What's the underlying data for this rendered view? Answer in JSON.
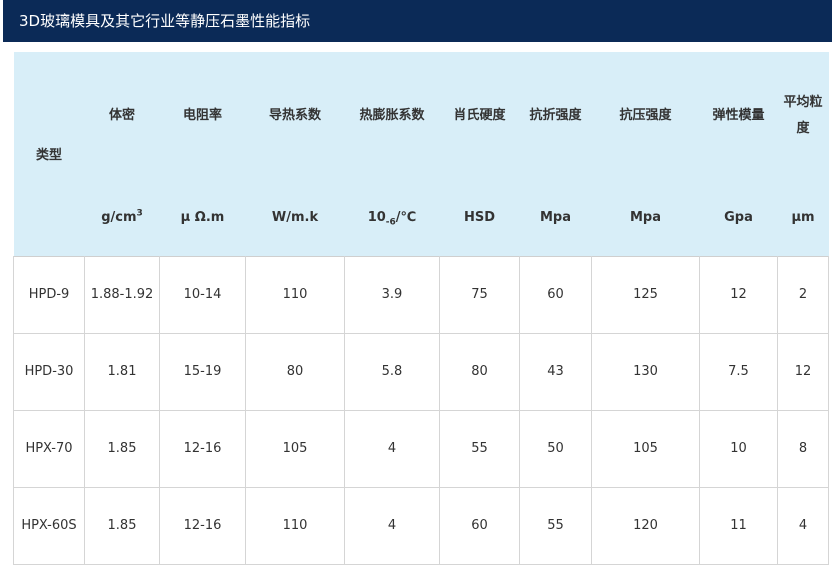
{
  "page_title": "3D玻璃模具及其它行业等静压石墨性能指标",
  "table": {
    "type_header": "类型",
    "columns": [
      {
        "name": "体密",
        "unit_main": "g/cm",
        "unit_sup": "3",
        "unit_sub": "",
        "unit_tail": ""
      },
      {
        "name": "电阻率",
        "unit_main": "μ Ω.m",
        "unit_sup": "",
        "unit_sub": "",
        "unit_tail": ""
      },
      {
        "name": "导热系数",
        "unit_main": "W/m.k",
        "unit_sup": "",
        "unit_sub": "",
        "unit_tail": ""
      },
      {
        "name": "热膨胀系数",
        "unit_main": "10",
        "unit_sup": "",
        "unit_sub": "-6",
        "unit_tail": "/℃"
      },
      {
        "name": "肖氏硬度",
        "unit_main": "HSD",
        "unit_sup": "",
        "unit_sub": "",
        "unit_tail": ""
      },
      {
        "name": "抗折强度",
        "unit_main": "Mpa",
        "unit_sup": "",
        "unit_sub": "",
        "unit_tail": ""
      },
      {
        "name": "抗压强度",
        "unit_main": "Mpa",
        "unit_sup": "",
        "unit_sub": "",
        "unit_tail": ""
      },
      {
        "name": "弹性模量",
        "unit_main": "Gpa",
        "unit_sup": "",
        "unit_sub": "",
        "unit_tail": ""
      },
      {
        "name": "平均粒度",
        "unit_main": "μm",
        "unit_sup": "",
        "unit_sub": "",
        "unit_tail": ""
      }
    ],
    "rows": [
      {
        "type": "HPD-9",
        "values": [
          "1.88-1.92",
          "10-14",
          "110",
          "3.9",
          "75",
          "60",
          "125",
          "12",
          "2"
        ]
      },
      {
        "type": "HPD-30",
        "values": [
          "1.81",
          "15-19",
          "80",
          "5.8",
          "80",
          "43",
          "130",
          "7.5",
          "12"
        ]
      },
      {
        "type": "HPX-70",
        "values": [
          "1.85",
          "12-16",
          "105",
          "4",
          "55",
          "50",
          "105",
          "10",
          "8"
        ]
      },
      {
        "type": "HPX-60S",
        "values": [
          "1.85",
          "12-16",
          "110",
          "4",
          "60",
          "55",
          "120",
          "11",
          "4"
        ]
      }
    ]
  }
}
